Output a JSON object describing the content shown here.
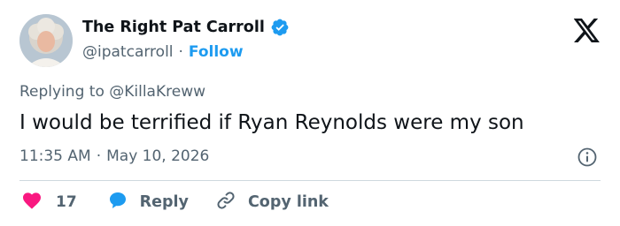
{
  "author": {
    "name": "The Right Pat Carroll",
    "handle": "@ipatcarroll",
    "follow_label": "Follow",
    "verified_color": "#1d9bf0"
  },
  "tweet": {
    "replying_to": "Replying to @KillaKreww",
    "text": "I would be terrified if Ryan Reynolds were my son",
    "time": "11:35 AM",
    "date": "May 10, 2026",
    "separator": "·"
  },
  "actions": {
    "likes_count": "17",
    "reply_label": "Reply",
    "copy_link_label": "Copy link"
  },
  "colors": {
    "accent": "#1d9bf0",
    "like": "#f91880",
    "text_secondary": "#536471"
  }
}
